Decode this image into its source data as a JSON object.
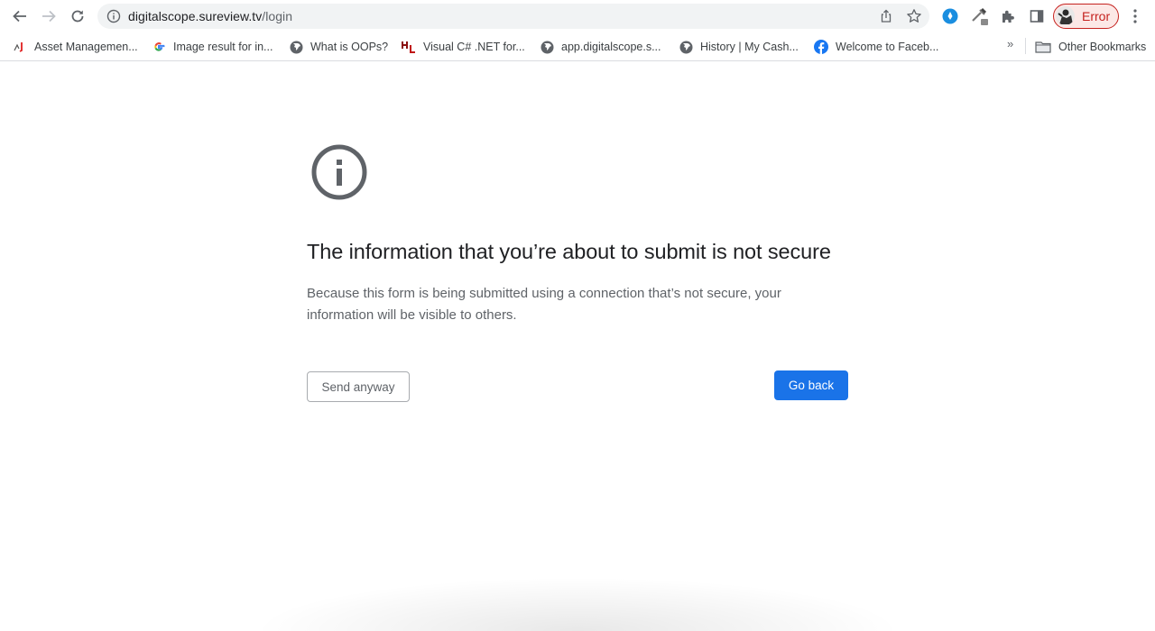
{
  "browser": {
    "url_host": "digitalscope.sureview.tv",
    "url_path": "/login",
    "profile_label": "Error",
    "accent_error": "#c5221f"
  },
  "bookmarks": {
    "items": [
      {
        "label": "Asset Managemen...",
        "icon": "asset-mgmt-icon"
      },
      {
        "label": "Image result for in...",
        "icon": "google-icon"
      },
      {
        "label": "What is OOPs?",
        "icon": "globe-icon"
      },
      {
        "label": "Visual C# .NET for...",
        "icon": "hl-icon"
      },
      {
        "label": "app.digitalscope.s...",
        "icon": "globe-icon"
      },
      {
        "label": "History | My Cash...",
        "icon": "globe-icon"
      },
      {
        "label": "Welcome to Faceb...",
        "icon": "facebook-icon"
      }
    ],
    "overflow": "»",
    "other_label": "Other Bookmarks"
  },
  "page": {
    "title": "The information that you’re about to submit is not secure",
    "description": "Because this form is being submitted using a connection that’s not secure, your information will be visible to others.",
    "send_anyway_label": "Send anyway",
    "go_back_label": "Go back",
    "primary_color": "#1a73e8"
  }
}
